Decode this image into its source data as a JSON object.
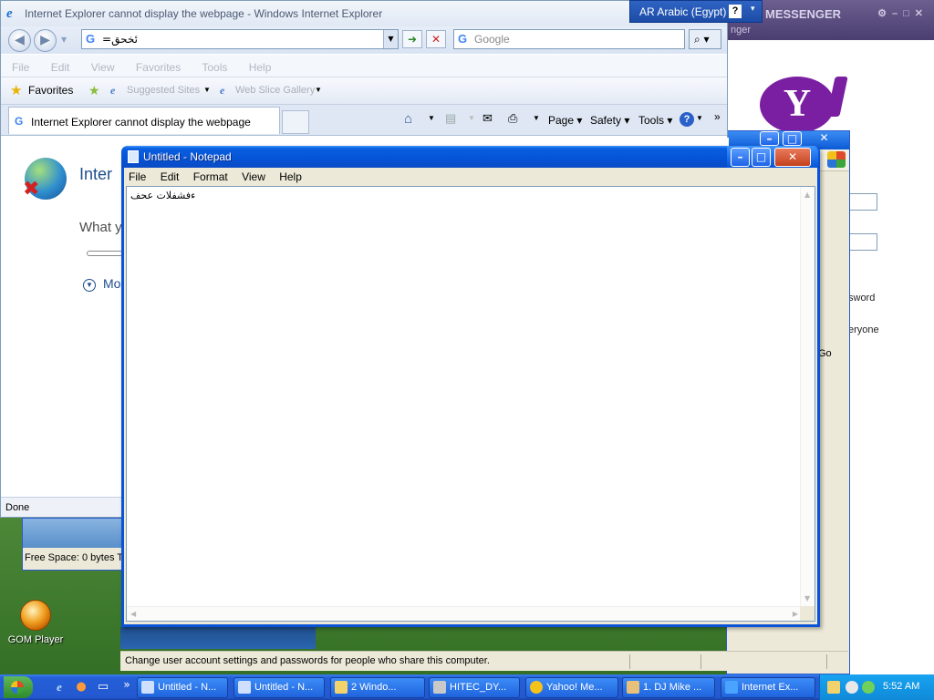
{
  "desktop": {
    "gom_label": "GOM Player"
  },
  "messenger": {
    "title": "MESSENGER",
    "subtitle": "nger",
    "logo_letter": "Y",
    "go_label": "Go",
    "text_password": "sword",
    "text_everyone": "eryone"
  },
  "ie": {
    "window_title": "Internet Explorer cannot display the webpage - Windows Internet Explorer",
    "address_value": "=ئخحق",
    "search_placeholder": "Google",
    "menu": [
      "File",
      "Edit",
      "View",
      "Favorites",
      "Tools",
      "Help"
    ],
    "favorites_label": "Favorites",
    "suggested_sites": "Suggested Sites",
    "web_slice": "Web Slice Gallery",
    "tab_title": "Internet Explorer cannot display the webpage",
    "cmd_page": "Page",
    "cmd_safety": "Safety",
    "cmd_tools": "Tools",
    "error_title": "Inter",
    "error_what": "What y",
    "error_more": "Mo",
    "status": "Done"
  },
  "language_bar": {
    "code": "AR",
    "language": "Arabic (Egypt)",
    "help": "?"
  },
  "explorer": {
    "free_space": "Free Space: 0 bytes T"
  },
  "control_panel": {
    "status_text": "Change user account settings and passwords for people who share this computer."
  },
  "notepad": {
    "title": "Untitled - Notepad",
    "menu": [
      "File",
      "Edit",
      "Format",
      "View",
      "Help"
    ],
    "content": "ءفشفلات عحف"
  },
  "taskbar": {
    "items": [
      {
        "label": "Untitled - N...",
        "icon_color": "#cfe0ff"
      },
      {
        "label": "Untitled - N...",
        "icon_color": "#cfe0ff"
      },
      {
        "label": "2 Windo...",
        "icon_color": "#f2d36b"
      },
      {
        "label": "HITEC_DY...",
        "icon_color": "#c9c9c9"
      },
      {
        "label": "Yahoo! Me...",
        "icon_color": "#f5c21a"
      },
      {
        "label": "1. DJ Mike ...",
        "icon_color": "#e8c07a"
      },
      {
        "label": "Internet Ex...",
        "icon_color": "#4aa3ff"
      }
    ],
    "overflow": "»",
    "clock": "5:52 AM"
  }
}
